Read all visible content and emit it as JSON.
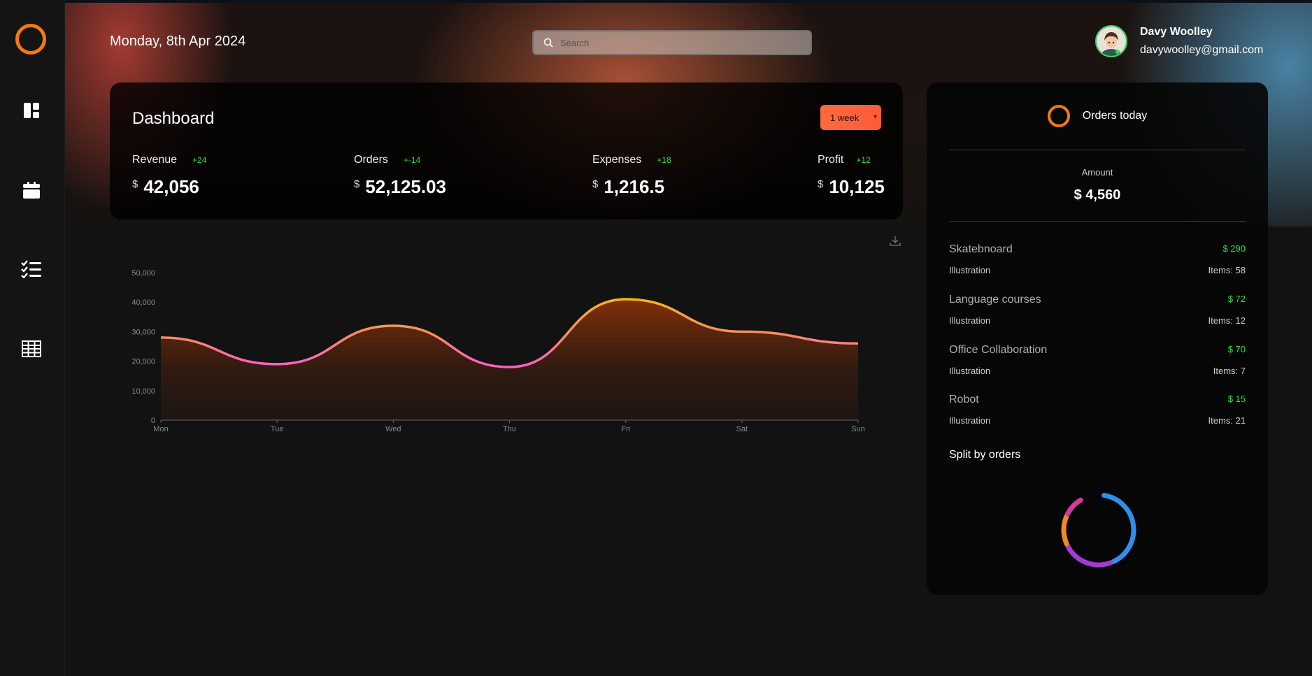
{
  "header": {
    "date": "Monday, 8th Apr 2024",
    "search_placeholder": "Search",
    "user_name": "Davy Woolley",
    "user_email": "davywoolley@gmail.com"
  },
  "sidebar": {
    "items": [
      {
        "icon": "dashboard-icon"
      },
      {
        "icon": "calendar-icon"
      },
      {
        "icon": "checklist-icon"
      },
      {
        "icon": "table-icon"
      }
    ]
  },
  "dashboard": {
    "title": "Dashboard",
    "range_label": "1 week",
    "stats": [
      {
        "label": "Revenue",
        "delta": "+24",
        "currency": "$",
        "value": "42,056"
      },
      {
        "label": "Orders",
        "delta": "+-14",
        "currency": "$",
        "value": "52,125.03"
      },
      {
        "label": "Expenses",
        "delta": "+18",
        "currency": "$",
        "value": "1,216.5"
      },
      {
        "label": "Profit",
        "delta": "+12",
        "currency": "$",
        "value": "10,125"
      }
    ]
  },
  "chart_data": {
    "type": "area",
    "categories": [
      "Mon",
      "Tue",
      "Wed",
      "Thu",
      "Fri",
      "Sat",
      "Sun"
    ],
    "values": [
      28000,
      19000,
      32000,
      18000,
      41000,
      30000,
      26000
    ],
    "yticks": [
      "0",
      "10,000",
      "20,000",
      "30,000",
      "40,000",
      "50,000"
    ],
    "ylim": [
      0,
      50000
    ],
    "grid": false
  },
  "orders_today": {
    "title": "Orders today",
    "amount_label": "Amount",
    "amount_value": "$ 4,560",
    "items": [
      {
        "name": "Skatebnoard",
        "price": "$ 290",
        "category": "Illustration",
        "items": "Items: 58"
      },
      {
        "name": "Language courses",
        "price": "$ 72",
        "category": "Illustration",
        "items": "Items: 12"
      },
      {
        "name": "Office Collaboration",
        "price": "$ 70",
        "category": "Illustration",
        "items": "Items: 7"
      },
      {
        "name": "Robot",
        "price": "$ 15",
        "category": "Illustration",
        "items": "Items: 21"
      }
    ],
    "split_title": "Split by orders",
    "split_segments": [
      {
        "value": 0.42,
        "color": "#2f8fea"
      },
      {
        "value": 0.24,
        "color": "#a23bd6"
      },
      {
        "value": 0.14,
        "color": "#f08a24"
      },
      {
        "value": 0.1,
        "color": "#d8389a"
      }
    ]
  },
  "colors": {
    "accent": "#f47a0e",
    "positive": "#22e03a",
    "range_button": "#ff6a3d"
  }
}
